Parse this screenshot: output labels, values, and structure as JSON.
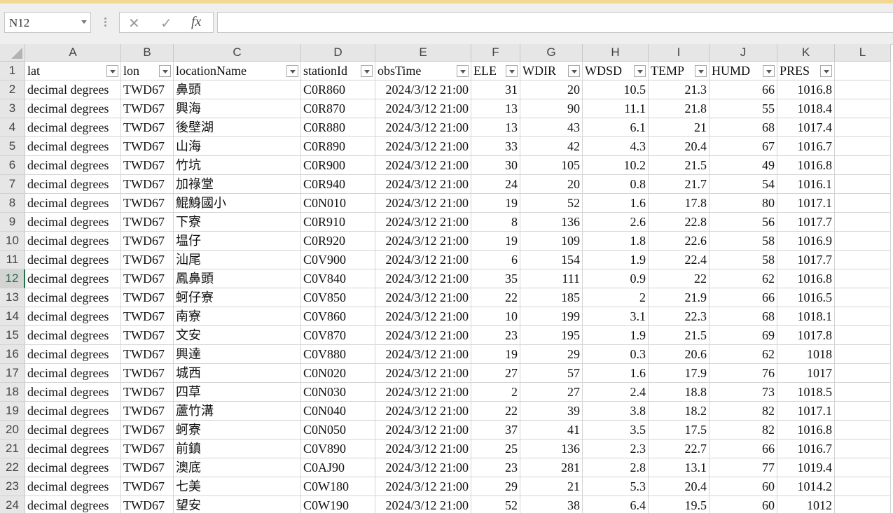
{
  "name_box": {
    "value": "N12"
  },
  "formula_bar": {
    "cancel_icon": "✕",
    "enter_icon": "✓",
    "fx_label": "fx",
    "value": ""
  },
  "columns": [
    "A",
    "B",
    "C",
    "D",
    "E",
    "F",
    "G",
    "H",
    "I",
    "J",
    "K",
    "L"
  ],
  "header_row": [
    "lat",
    "lon",
    "locationName",
    "stationId",
    "obsTime",
    "ELE",
    "WDIR",
    "WDSD",
    "TEMP",
    "HUMD",
    "PRES"
  ],
  "active_row": "12",
  "rows": [
    {
      "n": "2",
      "cells": [
        "decimal degrees",
        "TWD67",
        "鼻頭",
        "C0R860",
        "2024/3/12 21:00",
        "31",
        "20",
        "10.5",
        "21.3",
        "66",
        "1016.8"
      ]
    },
    {
      "n": "3",
      "cells": [
        "decimal degrees",
        "TWD67",
        "興海",
        "C0R870",
        "2024/3/12 21:00",
        "13",
        "90",
        "11.1",
        "21.8",
        "55",
        "1018.4"
      ]
    },
    {
      "n": "4",
      "cells": [
        "decimal degrees",
        "TWD67",
        "後壁湖",
        "C0R880",
        "2024/3/12 21:00",
        "13",
        "43",
        "6.1",
        "21",
        "68",
        "1017.4"
      ]
    },
    {
      "n": "5",
      "cells": [
        "decimal degrees",
        "TWD67",
        "山海",
        "C0R890",
        "2024/3/12 21:00",
        "33",
        "42",
        "4.3",
        "20.4",
        "67",
        "1016.7"
      ]
    },
    {
      "n": "6",
      "cells": [
        "decimal degrees",
        "TWD67",
        "竹坑",
        "C0R900",
        "2024/3/12 21:00",
        "30",
        "105",
        "10.2",
        "21.5",
        "49",
        "1016.8"
      ]
    },
    {
      "n": "7",
      "cells": [
        "decimal degrees",
        "TWD67",
        "加祿堂",
        "C0R940",
        "2024/3/12 21:00",
        "24",
        "20",
        "0.8",
        "21.7",
        "54",
        "1016.1"
      ]
    },
    {
      "n": "8",
      "cells": [
        "decimal degrees",
        "TWD67",
        "鯤鯓國小",
        "C0N010",
        "2024/3/12 21:00",
        "19",
        "52",
        "1.6",
        "17.8",
        "80",
        "1017.1"
      ]
    },
    {
      "n": "9",
      "cells": [
        "decimal degrees",
        "TWD67",
        "下寮",
        "C0R910",
        "2024/3/12 21:00",
        "8",
        "136",
        "2.6",
        "22.8",
        "56",
        "1017.7"
      ]
    },
    {
      "n": "10",
      "cells": [
        "decimal degrees",
        "TWD67",
        "塭仔",
        "C0R920",
        "2024/3/12 21:00",
        "19",
        "109",
        "1.8",
        "22.6",
        "58",
        "1016.9"
      ]
    },
    {
      "n": "11",
      "cells": [
        "decimal degrees",
        "TWD67",
        "汕尾",
        "C0V900",
        "2024/3/12 21:00",
        "6",
        "154",
        "1.9",
        "22.4",
        "58",
        "1017.7"
      ]
    },
    {
      "n": "12",
      "cells": [
        "decimal degrees",
        "TWD67",
        "鳳鼻頭",
        "C0V840",
        "2024/3/12 21:00",
        "35",
        "111",
        "0.9",
        "22",
        "62",
        "1016.8"
      ]
    },
    {
      "n": "13",
      "cells": [
        "decimal degrees",
        "TWD67",
        "蚵仔寮",
        "C0V850",
        "2024/3/12 21:00",
        "22",
        "185",
        "2",
        "21.9",
        "66",
        "1016.5"
      ]
    },
    {
      "n": "14",
      "cells": [
        "decimal degrees",
        "TWD67",
        "南寮",
        "C0V860",
        "2024/3/12 21:00",
        "10",
        "199",
        "3.1",
        "22.3",
        "68",
        "1018.1"
      ]
    },
    {
      "n": "15",
      "cells": [
        "decimal degrees",
        "TWD67",
        "文安",
        "C0V870",
        "2024/3/12 21:00",
        "23",
        "195",
        "1.9",
        "21.5",
        "69",
        "1017.8"
      ]
    },
    {
      "n": "16",
      "cells": [
        "decimal degrees",
        "TWD67",
        "興達",
        "C0V880",
        "2024/3/12 21:00",
        "19",
        "29",
        "0.3",
        "20.6",
        "62",
        "1018"
      ]
    },
    {
      "n": "17",
      "cells": [
        "decimal degrees",
        "TWD67",
        "城西",
        "C0N020",
        "2024/3/12 21:00",
        "27",
        "57",
        "1.6",
        "17.9",
        "76",
        "1017"
      ]
    },
    {
      "n": "18",
      "cells": [
        "decimal degrees",
        "TWD67",
        "四草",
        "C0N030",
        "2024/3/12 21:00",
        "2",
        "27",
        "2.4",
        "18.8",
        "73",
        "1018.5"
      ]
    },
    {
      "n": "19",
      "cells": [
        "decimal degrees",
        "TWD67",
        "蘆竹溝",
        "C0N040",
        "2024/3/12 21:00",
        "22",
        "39",
        "3.8",
        "18.2",
        "82",
        "1017.1"
      ]
    },
    {
      "n": "20",
      "cells": [
        "decimal degrees",
        "TWD67",
        "蚵寮",
        "C0N050",
        "2024/3/12 21:00",
        "37",
        "41",
        "3.5",
        "17.5",
        "82",
        "1016.8"
      ]
    },
    {
      "n": "21",
      "cells": [
        "decimal degrees",
        "TWD67",
        "前鎮",
        "C0V890",
        "2024/3/12 21:00",
        "25",
        "136",
        "2.3",
        "22.7",
        "66",
        "1016.7"
      ]
    },
    {
      "n": "22",
      "cells": [
        "decimal degrees",
        "TWD67",
        "澳底",
        "C0AJ90",
        "2024/3/12 21:00",
        "23",
        "281",
        "2.8",
        "13.1",
        "77",
        "1019.4"
      ]
    },
    {
      "n": "23",
      "cells": [
        "decimal degrees",
        "TWD67",
        "七美",
        "C0W180",
        "2024/3/12 21:00",
        "29",
        "21",
        "5.3",
        "20.4",
        "60",
        "1014.2"
      ]
    },
    {
      "n": "24",
      "cells": [
        "decimal degrees",
        "TWD67",
        "望安",
        "C0W190",
        "2024/3/12 21:00",
        "52",
        "38",
        "6.4",
        "19.5",
        "60",
        "1012"
      ]
    }
  ],
  "colors": {
    "accent": "#217346",
    "header_bg": "#e6e6e6",
    "topbar": "#f1d993"
  }
}
